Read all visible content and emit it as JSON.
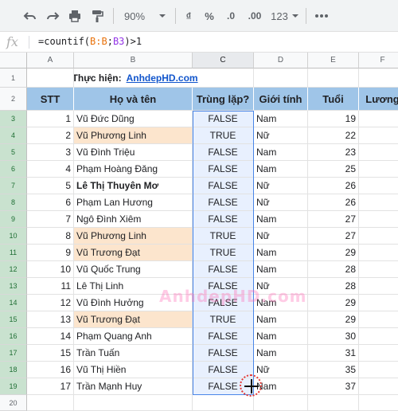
{
  "toolbar": {
    "zoom": "90%",
    "currency": "₫",
    "percent": "%",
    "decrease_decimal": ".0",
    "increase_decimal": ".00",
    "number_format": "123"
  },
  "formula_bar": {
    "fx_label": "fx",
    "prefix": "=countif(",
    "ref_b": "B:B",
    "comma": ";",
    "ref_c": "B3",
    "suffix": ")>1"
  },
  "columns": [
    "A",
    "B",
    "C",
    "D",
    "E",
    "F"
  ],
  "row_numbers": [
    "1",
    "2",
    "3",
    "4",
    "5",
    "6",
    "7",
    "8",
    "9",
    "10",
    "11",
    "12",
    "13",
    "14",
    "15",
    "16",
    "17",
    "18",
    "19",
    "20"
  ],
  "title_row": {
    "label": "Thực hiện:",
    "link": "AnhdepHD.com"
  },
  "headers": {
    "stt": "STT",
    "name": "Họ và tên",
    "dup": "Trùng lặp?",
    "gender": "Giới tính",
    "age": "Tuổi",
    "salary": "Lương"
  },
  "rows": [
    {
      "stt": "1",
      "name": "Vũ Đức Dũng",
      "dup": "FALSE",
      "gender": "Nam",
      "age": "19"
    },
    {
      "stt": "2",
      "name": "Vũ Phương Linh",
      "dup": "TRUE",
      "gender": "Nữ",
      "age": "22"
    },
    {
      "stt": "3",
      "name": "Vũ Đình Triệu",
      "dup": "FALSE",
      "gender": "Nam",
      "age": "23"
    },
    {
      "stt": "4",
      "name": "Phạm Hoàng Đăng",
      "dup": "FALSE",
      "gender": "Nam",
      "age": "25"
    },
    {
      "stt": "5",
      "name": "Lê Thị Thuyên Mơ",
      "dup": "FALSE",
      "gender": "Nữ",
      "age": "26"
    },
    {
      "stt": "6",
      "name": "Phạm Lan Hương",
      "dup": "FALSE",
      "gender": "Nữ",
      "age": "26"
    },
    {
      "stt": "7",
      "name": "Ngô Đình Xiêm",
      "dup": "FALSE",
      "gender": "Nam",
      "age": "27"
    },
    {
      "stt": "8",
      "name": "Vũ Phương Linh",
      "dup": "TRUE",
      "gender": "Nữ",
      "age": "27"
    },
    {
      "stt": "9",
      "name": "Vũ Trương Đạt",
      "dup": "TRUE",
      "gender": "Nam",
      "age": "29"
    },
    {
      "stt": "10",
      "name": "Vũ Quốc Trung",
      "dup": "FALSE",
      "gender": "Nam",
      "age": "28"
    },
    {
      "stt": "11",
      "name": "Lê Thị Linh",
      "dup": "FALSE",
      "gender": "Nữ",
      "age": "28"
    },
    {
      "stt": "12",
      "name": "Vũ Đình Hưởng",
      "dup": "FALSE",
      "gender": "Nam",
      "age": "29"
    },
    {
      "stt": "13",
      "name": "Vũ Trương Đạt",
      "dup": "TRUE",
      "gender": "Nam",
      "age": "29"
    },
    {
      "stt": "14",
      "name": "Phạm Quang Anh",
      "dup": "FALSE",
      "gender": "Nam",
      "age": "30"
    },
    {
      "stt": "15",
      "name": "Trần Tuấn",
      "dup": "FALSE",
      "gender": "Nam",
      "age": "31"
    },
    {
      "stt": "16",
      "name": "Vũ Thị Hiền",
      "dup": "FALSE",
      "gender": "Nữ",
      "age": "35"
    },
    {
      "stt": "17",
      "name": "Trần Mạnh Huy",
      "dup": "FALSE",
      "gender": "Nam",
      "age": "37"
    }
  ],
  "watermark": "AnhdepHD.com",
  "colors": {
    "header_fill": "#9fc5e8",
    "duplicate_fill": "#fce5cd",
    "selection": "#4a86e8"
  }
}
